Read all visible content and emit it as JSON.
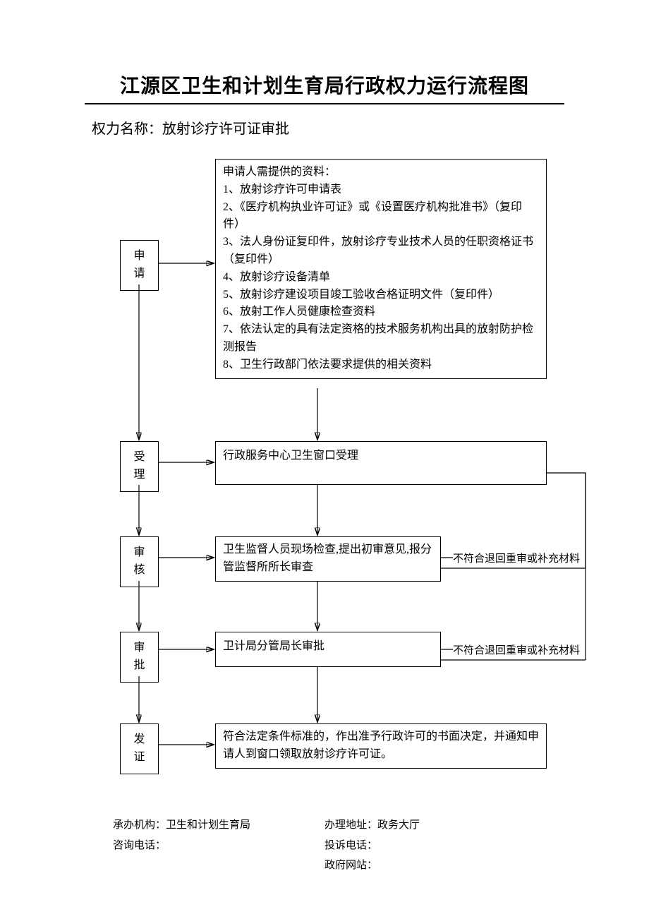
{
  "title": "江源区卫生和计划生育局行政权力运行流程图",
  "subtitle": "权力名称：放射诊疗许可证审批",
  "steps": {
    "s1": "申\n请",
    "s2": "受\n理",
    "s3": "审\n核",
    "s4": "审\n批",
    "s5": "发\n证"
  },
  "boxes": {
    "materials": "申请人需提供的资料：\n1、放射诊疗许可申请表\n2、《医疗机构执业许可证》或《设置医疗机构批准书》（复印件）\n3、法人身份证复印件，放射诊疗专业技术人员的任职资格证书（复印件）\n4、放射诊疗设备清单\n5、放射诊疗建设项目竣工验收合格证明文件（复印件）\n6、放射工作人员健康检查资料\n7、依法认定的具有法定资格的技术服务机构出具的放射防护检测报告\n8、卫生行政部门依法要求提供的相关资料",
    "accept": "行政服务中心卫生窗口受理",
    "review": "卫生监督人员现场检查,提出初审意见,报分管监督所所长审查",
    "approve": "卫计局分管局长审批",
    "issue": "符合法定条件标准的，作出准予行政许可的书面决定，并通知申请人到窗口领取放射诊疗许可证。"
  },
  "notes": {
    "reject1": "不符合退回重审或补充材料",
    "reject2": "不符合退回重审或补充材料"
  },
  "footer": {
    "org_label": "承办机构：",
    "org_value": "卫生和计划生育局",
    "addr_label": "办理地址：",
    "addr_value": "政务大厅",
    "tel_label": "咨询电话：",
    "complain_label": "投诉电话：",
    "site_label": "政府网站："
  }
}
